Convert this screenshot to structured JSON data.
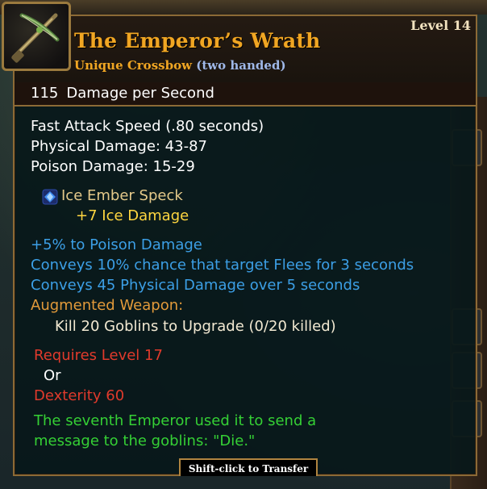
{
  "item": {
    "level": "Level 14",
    "name": "The Emperor’s Wrath",
    "rarity": "Unique Crossbow",
    "hands": "(two handed)",
    "icon": "crossbow-icon"
  },
  "dps": {
    "value": "115",
    "label": "Damage per Second"
  },
  "stats": {
    "attack_speed": "Fast Attack Speed (.80 seconds)",
    "physical": "Physical Damage: 43-87",
    "poison": "Poison Damage: 15-29"
  },
  "socket": {
    "gem_name": "Ice Ember Speck",
    "gem_effect": "+7 Ice Damage",
    "gem_icon": "blue-gem-icon"
  },
  "modifiers": [
    "+5% to Poison Damage",
    "Conveys 10% chance that target Flees for 3 seconds",
    "Conveys 45 Physical Damage over 5 seconds"
  ],
  "augment": {
    "title": "Augmented Weapon:",
    "task": "Kill 20 Goblins to Upgrade (0/20 killed)"
  },
  "requirements": {
    "level": "Requires Level 17",
    "or": "Or",
    "dexterity": "Dexterity 60"
  },
  "flavor": {
    "line1": "The seventh Emperor used it to send a",
    "line2": "message to the goblins: \"Die.\""
  },
  "actions": {
    "transfer": "Shift-click to Transfer"
  },
  "colors": {
    "name": "#f0a623",
    "blue_mod": "#3c9fe6",
    "requirement": "#e03a2c",
    "flavor": "#35d035",
    "border": "#8c6a36"
  }
}
